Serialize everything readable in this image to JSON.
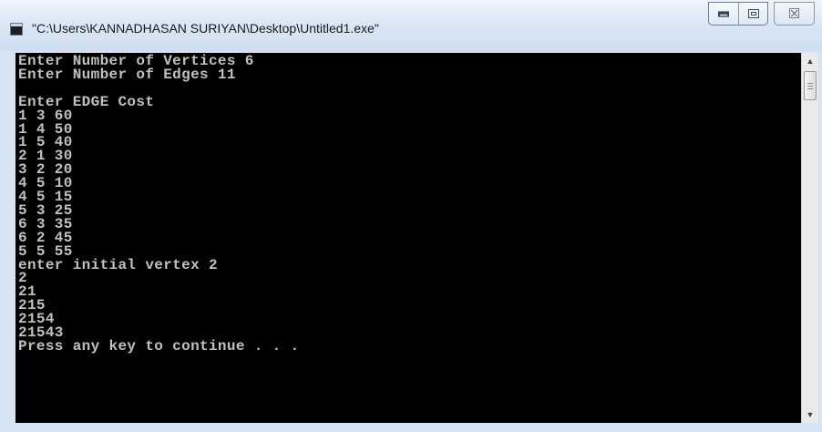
{
  "window": {
    "title": "\"C:\\Users\\KANNADHASAN SURIYAN\\Desktop\\Untitled1.exe\"",
    "app_icon": "console-app-icon",
    "controls": {
      "minimize_icon": "minimize-icon",
      "maximize_icon": "maximize-icon",
      "close_glyph": "☒"
    }
  },
  "console": {
    "text_color": "#c0c0c0",
    "background_color": "#000000",
    "lines": [
      "Enter Number of Vertices 6",
      "Enter Number of Edges 11",
      "",
      "Enter EDGE Cost",
      "1 3 60",
      "1 4 50",
      "1 5 40",
      "2 1 30",
      "3 2 20",
      "4 5 10",
      "4 5 15",
      "5 3 25",
      "6 3 35",
      "6 2 45",
      "5 5 55",
      "enter initial vertex 2",
      "2",
      "21",
      "215",
      "2154",
      "21543",
      "Press any key to continue . . ."
    ]
  },
  "scrollbar": {
    "up_arrow": "▲",
    "down_arrow": "▼"
  }
}
